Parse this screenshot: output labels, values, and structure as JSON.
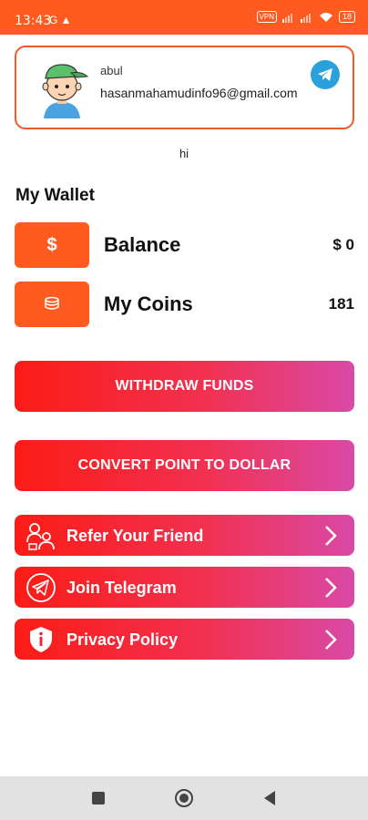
{
  "status_bar": {
    "time": "13:43",
    "left_icons": "G ▲",
    "vpn": "VPN",
    "battery": "18"
  },
  "profile": {
    "name": "abul",
    "email": "hasanmahamudinfo96@gmail.com",
    "avatar_icon": "cartoon-boy-avatar",
    "telegram_icon": "telegram-icon"
  },
  "greeting": "hi",
  "wallet": {
    "title": "My Wallet",
    "balance": {
      "label": "Balance",
      "value": "$ 0",
      "icon_text": "$"
    },
    "coins": {
      "label": "My Coins",
      "value": "181",
      "icon": "coins-icon"
    }
  },
  "buttons": {
    "withdraw": "WITHDRAW FUNDS",
    "convert": "CONVERT POINT TO DOLLAR"
  },
  "menu": [
    {
      "label": "Refer Your Friend",
      "icon": "refer-friends-icon"
    },
    {
      "label": "Join Telegram",
      "icon": "telegram-icon"
    },
    {
      "label": "Privacy Policy",
      "icon": "shield-info-icon"
    }
  ],
  "colors": {
    "accent": "#ff5a1f",
    "gradient_start": "#fb1c16",
    "gradient_end": "#d94aa6",
    "telegram": "#2aa1db"
  },
  "nav": {
    "items": [
      "recent-apps",
      "home",
      "back"
    ]
  }
}
